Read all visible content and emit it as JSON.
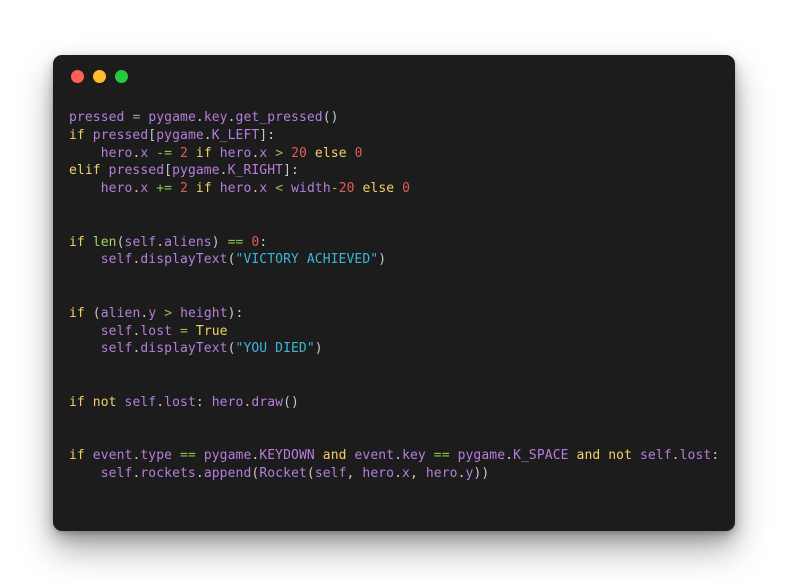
{
  "window": {
    "background_color": "#1c1c1c",
    "page_background_color": "#ffffff",
    "traffic_lights": [
      {
        "name": "close",
        "color": "#ff5f56"
      },
      {
        "name": "minimize",
        "color": "#ffbd2e"
      },
      {
        "name": "maximize",
        "color": "#27c93f"
      }
    ]
  },
  "theme": {
    "keyword_color": "#f4d06a",
    "identifier_color": "#b57edc",
    "builtin_function_color": "#a9d45c",
    "number_color": "#e05d5d",
    "string_color": "#3cb5d9",
    "operator_color": "#8bc34a",
    "punctuation_color": "#c8c8d0",
    "default_text_color": "#cbb9e8"
  },
  "code": {
    "language": "python",
    "lines": [
      [
        {
          "text": "pressed",
          "type": "name"
        },
        {
          "text": " ",
          "type": "plain"
        },
        {
          "text": "=",
          "type": "eq"
        },
        {
          "text": " ",
          "type": "plain"
        },
        {
          "text": "pygame",
          "type": "name"
        },
        {
          "text": ".",
          "type": "punc"
        },
        {
          "text": "key",
          "type": "name"
        },
        {
          "text": ".",
          "type": "punc"
        },
        {
          "text": "get_pressed",
          "type": "name"
        },
        {
          "text": "()",
          "type": "punc"
        }
      ],
      [
        {
          "text": "if",
          "type": "kw"
        },
        {
          "text": " ",
          "type": "plain"
        },
        {
          "text": "pressed",
          "type": "name"
        },
        {
          "text": "[",
          "type": "punc"
        },
        {
          "text": "pygame",
          "type": "name"
        },
        {
          "text": ".",
          "type": "punc"
        },
        {
          "text": "K_LEFT",
          "type": "name"
        },
        {
          "text": "]:",
          "type": "punc"
        }
      ],
      [
        {
          "text": "    ",
          "type": "plain"
        },
        {
          "text": "hero",
          "type": "name"
        },
        {
          "text": ".",
          "type": "punc"
        },
        {
          "text": "x",
          "type": "name"
        },
        {
          "text": " ",
          "type": "plain"
        },
        {
          "text": "-=",
          "type": "op"
        },
        {
          "text": " ",
          "type": "plain"
        },
        {
          "text": "2",
          "type": "num"
        },
        {
          "text": " ",
          "type": "plain"
        },
        {
          "text": "if",
          "type": "kw"
        },
        {
          "text": " ",
          "type": "plain"
        },
        {
          "text": "hero",
          "type": "name"
        },
        {
          "text": ".",
          "type": "punc"
        },
        {
          "text": "x",
          "type": "name"
        },
        {
          "text": " ",
          "type": "plain"
        },
        {
          "text": ">",
          "type": "op"
        },
        {
          "text": " ",
          "type": "plain"
        },
        {
          "text": "20",
          "type": "num"
        },
        {
          "text": " ",
          "type": "plain"
        },
        {
          "text": "else",
          "type": "kw"
        },
        {
          "text": " ",
          "type": "plain"
        },
        {
          "text": "0",
          "type": "num"
        }
      ],
      [
        {
          "text": "elif",
          "type": "kw"
        },
        {
          "text": " ",
          "type": "plain"
        },
        {
          "text": "pressed",
          "type": "name"
        },
        {
          "text": "[",
          "type": "punc"
        },
        {
          "text": "pygame",
          "type": "name"
        },
        {
          "text": ".",
          "type": "punc"
        },
        {
          "text": "K_RIGHT",
          "type": "name"
        },
        {
          "text": "]:",
          "type": "punc"
        }
      ],
      [
        {
          "text": "    ",
          "type": "plain"
        },
        {
          "text": "hero",
          "type": "name"
        },
        {
          "text": ".",
          "type": "punc"
        },
        {
          "text": "x",
          "type": "name"
        },
        {
          "text": " ",
          "type": "plain"
        },
        {
          "text": "+=",
          "type": "op"
        },
        {
          "text": " ",
          "type": "plain"
        },
        {
          "text": "2",
          "type": "num"
        },
        {
          "text": " ",
          "type": "plain"
        },
        {
          "text": "if",
          "type": "kw"
        },
        {
          "text": " ",
          "type": "plain"
        },
        {
          "text": "hero",
          "type": "name"
        },
        {
          "text": ".",
          "type": "punc"
        },
        {
          "text": "x",
          "type": "name"
        },
        {
          "text": " ",
          "type": "plain"
        },
        {
          "text": "<",
          "type": "op"
        },
        {
          "text": " ",
          "type": "plain"
        },
        {
          "text": "width",
          "type": "name"
        },
        {
          "text": "-",
          "type": "op"
        },
        {
          "text": "20",
          "type": "num"
        },
        {
          "text": " ",
          "type": "plain"
        },
        {
          "text": "else",
          "type": "kw"
        },
        {
          "text": " ",
          "type": "plain"
        },
        {
          "text": "0",
          "type": "num"
        }
      ],
      [],
      [],
      [
        {
          "text": "if",
          "type": "kw"
        },
        {
          "text": " ",
          "type": "plain"
        },
        {
          "text": "len",
          "type": "fn"
        },
        {
          "text": "(",
          "type": "punc"
        },
        {
          "text": "self",
          "type": "name"
        },
        {
          "text": ".",
          "type": "punc"
        },
        {
          "text": "aliens",
          "type": "name"
        },
        {
          "text": ")",
          "type": "punc"
        },
        {
          "text": " ",
          "type": "plain"
        },
        {
          "text": "==",
          "type": "op"
        },
        {
          "text": " ",
          "type": "plain"
        },
        {
          "text": "0",
          "type": "num"
        },
        {
          "text": ":",
          "type": "punc"
        }
      ],
      [
        {
          "text": "    ",
          "type": "plain"
        },
        {
          "text": "self",
          "type": "name"
        },
        {
          "text": ".",
          "type": "punc"
        },
        {
          "text": "displayText",
          "type": "name"
        },
        {
          "text": "(",
          "type": "punc"
        },
        {
          "text": "\"VICTORY ACHIEVED\"",
          "type": "str"
        },
        {
          "text": ")",
          "type": "punc"
        }
      ],
      [],
      [],
      [
        {
          "text": "if",
          "type": "kw"
        },
        {
          "text": " ",
          "type": "plain"
        },
        {
          "text": "(",
          "type": "punc"
        },
        {
          "text": "alien",
          "type": "name"
        },
        {
          "text": ".",
          "type": "punc"
        },
        {
          "text": "y",
          "type": "name"
        },
        {
          "text": " ",
          "type": "plain"
        },
        {
          "text": ">",
          "type": "op"
        },
        {
          "text": " ",
          "type": "plain"
        },
        {
          "text": "height",
          "type": "name"
        },
        {
          "text": "):",
          "type": "punc"
        }
      ],
      [
        {
          "text": "    ",
          "type": "plain"
        },
        {
          "text": "self",
          "type": "name"
        },
        {
          "text": ".",
          "type": "punc"
        },
        {
          "text": "lost",
          "type": "name"
        },
        {
          "text": " ",
          "type": "plain"
        },
        {
          "text": "=",
          "type": "op"
        },
        {
          "text": " ",
          "type": "plain"
        },
        {
          "text": "True",
          "type": "const"
        }
      ],
      [
        {
          "text": "    ",
          "type": "plain"
        },
        {
          "text": "self",
          "type": "name"
        },
        {
          "text": ".",
          "type": "punc"
        },
        {
          "text": "displayText",
          "type": "name"
        },
        {
          "text": "(",
          "type": "punc"
        },
        {
          "text": "\"YOU DIED\"",
          "type": "str"
        },
        {
          "text": ")",
          "type": "punc"
        }
      ],
      [],
      [],
      [
        {
          "text": "if",
          "type": "kw"
        },
        {
          "text": " ",
          "type": "plain"
        },
        {
          "text": "not",
          "type": "kw"
        },
        {
          "text": " ",
          "type": "plain"
        },
        {
          "text": "self",
          "type": "name"
        },
        {
          "text": ".",
          "type": "punc"
        },
        {
          "text": "lost",
          "type": "name"
        },
        {
          "text": ": ",
          "type": "punc"
        },
        {
          "text": "hero",
          "type": "name"
        },
        {
          "text": ".",
          "type": "punc"
        },
        {
          "text": "draw",
          "type": "name"
        },
        {
          "text": "()",
          "type": "punc"
        }
      ],
      [],
      [],
      [
        {
          "text": "if",
          "type": "kw"
        },
        {
          "text": " ",
          "type": "plain"
        },
        {
          "text": "event",
          "type": "name"
        },
        {
          "text": ".",
          "type": "punc"
        },
        {
          "text": "type",
          "type": "name"
        },
        {
          "text": " ",
          "type": "plain"
        },
        {
          "text": "==",
          "type": "op"
        },
        {
          "text": " ",
          "type": "plain"
        },
        {
          "text": "pygame",
          "type": "name"
        },
        {
          "text": ".",
          "type": "punc"
        },
        {
          "text": "KEYDOWN",
          "type": "name"
        },
        {
          "text": " ",
          "type": "plain"
        },
        {
          "text": "and",
          "type": "kw"
        },
        {
          "text": " ",
          "type": "plain"
        },
        {
          "text": "event",
          "type": "name"
        },
        {
          "text": ".",
          "type": "punc"
        },
        {
          "text": "key",
          "type": "name"
        },
        {
          "text": " ",
          "type": "plain"
        },
        {
          "text": "==",
          "type": "op"
        },
        {
          "text": " ",
          "type": "plain"
        },
        {
          "text": "pygame",
          "type": "name"
        },
        {
          "text": ".",
          "type": "punc"
        },
        {
          "text": "K_SPACE",
          "type": "name"
        },
        {
          "text": " ",
          "type": "plain"
        },
        {
          "text": "and",
          "type": "kw"
        },
        {
          "text": " ",
          "type": "plain"
        },
        {
          "text": "not",
          "type": "kw"
        },
        {
          "text": " ",
          "type": "plain"
        },
        {
          "text": "self",
          "type": "name"
        },
        {
          "text": ".",
          "type": "punc"
        },
        {
          "text": "lost",
          "type": "name"
        },
        {
          "text": ":",
          "type": "punc"
        }
      ],
      [
        {
          "text": "    ",
          "type": "plain"
        },
        {
          "text": "self",
          "type": "name"
        },
        {
          "text": ".",
          "type": "punc"
        },
        {
          "text": "rockets",
          "type": "name"
        },
        {
          "text": ".",
          "type": "punc"
        },
        {
          "text": "append",
          "type": "name"
        },
        {
          "text": "(",
          "type": "punc"
        },
        {
          "text": "Rocket",
          "type": "name"
        },
        {
          "text": "(",
          "type": "punc"
        },
        {
          "text": "self",
          "type": "name"
        },
        {
          "text": ", ",
          "type": "punc"
        },
        {
          "text": "hero",
          "type": "name"
        },
        {
          "text": ".",
          "type": "punc"
        },
        {
          "text": "x",
          "type": "name"
        },
        {
          "text": ", ",
          "type": "punc"
        },
        {
          "text": "hero",
          "type": "name"
        },
        {
          "text": ".",
          "type": "punc"
        },
        {
          "text": "y",
          "type": "name"
        },
        {
          "text": "))",
          "type": "punc"
        }
      ]
    ]
  }
}
